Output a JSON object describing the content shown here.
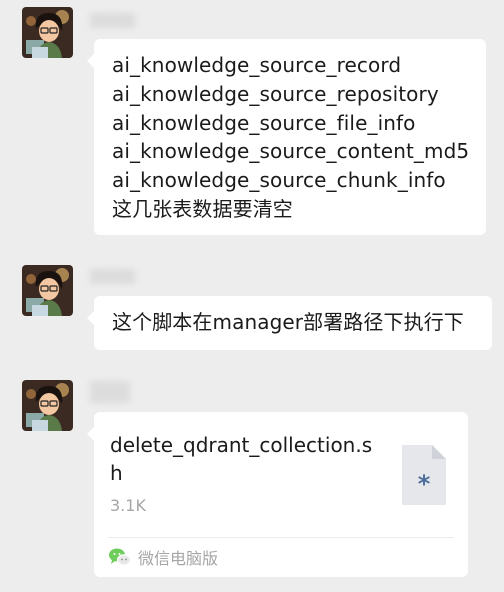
{
  "messages": [
    {
      "type": "text",
      "text": "ai_knowledge_source_record\nai_knowledge_source_repository\nai_knowledge_source_file_info\nai_knowledge_source_content_md5\nai_knowledge_source_chunk_info\n这几张表数据要清空"
    },
    {
      "type": "text",
      "text": "这个脚本在manager部署路径下执行下"
    },
    {
      "type": "file",
      "file_name": "delete_qdrant_collection.sh",
      "file_size": "3.1K",
      "source": "微信电脑版",
      "file_icon": "script-file-icon",
      "source_icon": "wechat-icon"
    }
  ],
  "colors": {
    "background": "#ededed",
    "bubble": "#ffffff",
    "text": "#1b1b1b",
    "muted": "#a6a6a6",
    "file_icon_bg": "#e6e7ea",
    "file_icon_mark": "#4b6e9c",
    "wechat_green": "#6fcd5b"
  }
}
